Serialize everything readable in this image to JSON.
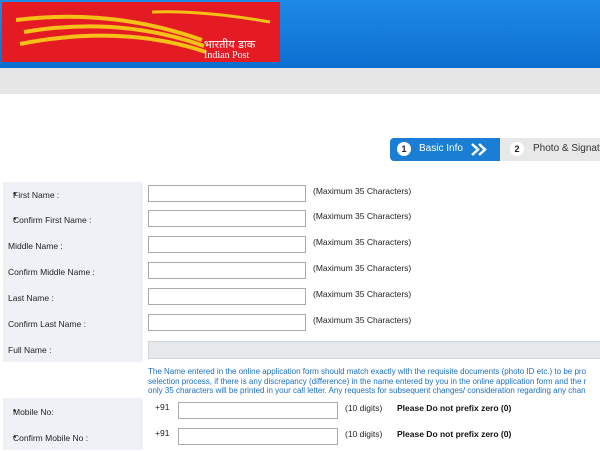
{
  "header": {
    "logo_hindi": "भारतीय डाक",
    "logo_english": "Indian Post",
    "bar_color": "#1a7fd4",
    "logo_color": "#e41b23"
  },
  "steps": [
    {
      "number": "1",
      "label": "Basic Info",
      "active": true
    },
    {
      "number": "2",
      "label": "Photo & Signature",
      "active": false
    }
  ],
  "form": {
    "first_name": {
      "label": "First Name :",
      "required": "*",
      "hint": "(Maximum 35 Characters)",
      "value": ""
    },
    "confirm_first_name": {
      "label": "Confirm First Name :",
      "required": "*",
      "hint": "(Maximum 35 Characters)",
      "value": ""
    },
    "middle_name": {
      "label": "Middle Name :",
      "hint": "(Maximum 35 Characters)",
      "value": ""
    },
    "confirm_middle_name": {
      "label": "Confirm Middle Name :",
      "hint": "(Maximum 35 Characters)",
      "value": ""
    },
    "last_name": {
      "label": "Last Name :",
      "hint": "(Maximum 35 Characters)",
      "value": ""
    },
    "confirm_last_name": {
      "label": "Confirm Last Name :",
      "hint": "(Maximum 35 Characters)",
      "value": ""
    },
    "full_name": {
      "label": "Full Name :",
      "value": ""
    },
    "note_lines": [
      "The Name entered in the online application form should match exactly with the requisite documents (photo ID etc.) to be pro",
      "selection process, if there is any discrepancy (difference) in the name entered by you in the online application form and the r",
      "only 35 characters will be printed in your call letter. Any requests for subsequent changes/ consideration regarding any chan"
    ],
    "mobile": {
      "label": "Mobile No:",
      "required": "*",
      "prefix": "+91",
      "digits": "(10 digits)",
      "warning": "Please Do not prefix zero (0)",
      "value": ""
    },
    "confirm_mobile": {
      "label": "Confirm Mobile No :",
      "required": "*",
      "prefix": "+91",
      "digits": "(10 digits)",
      "warning": "Please Do not prefix zero (0)",
      "value": ""
    }
  }
}
